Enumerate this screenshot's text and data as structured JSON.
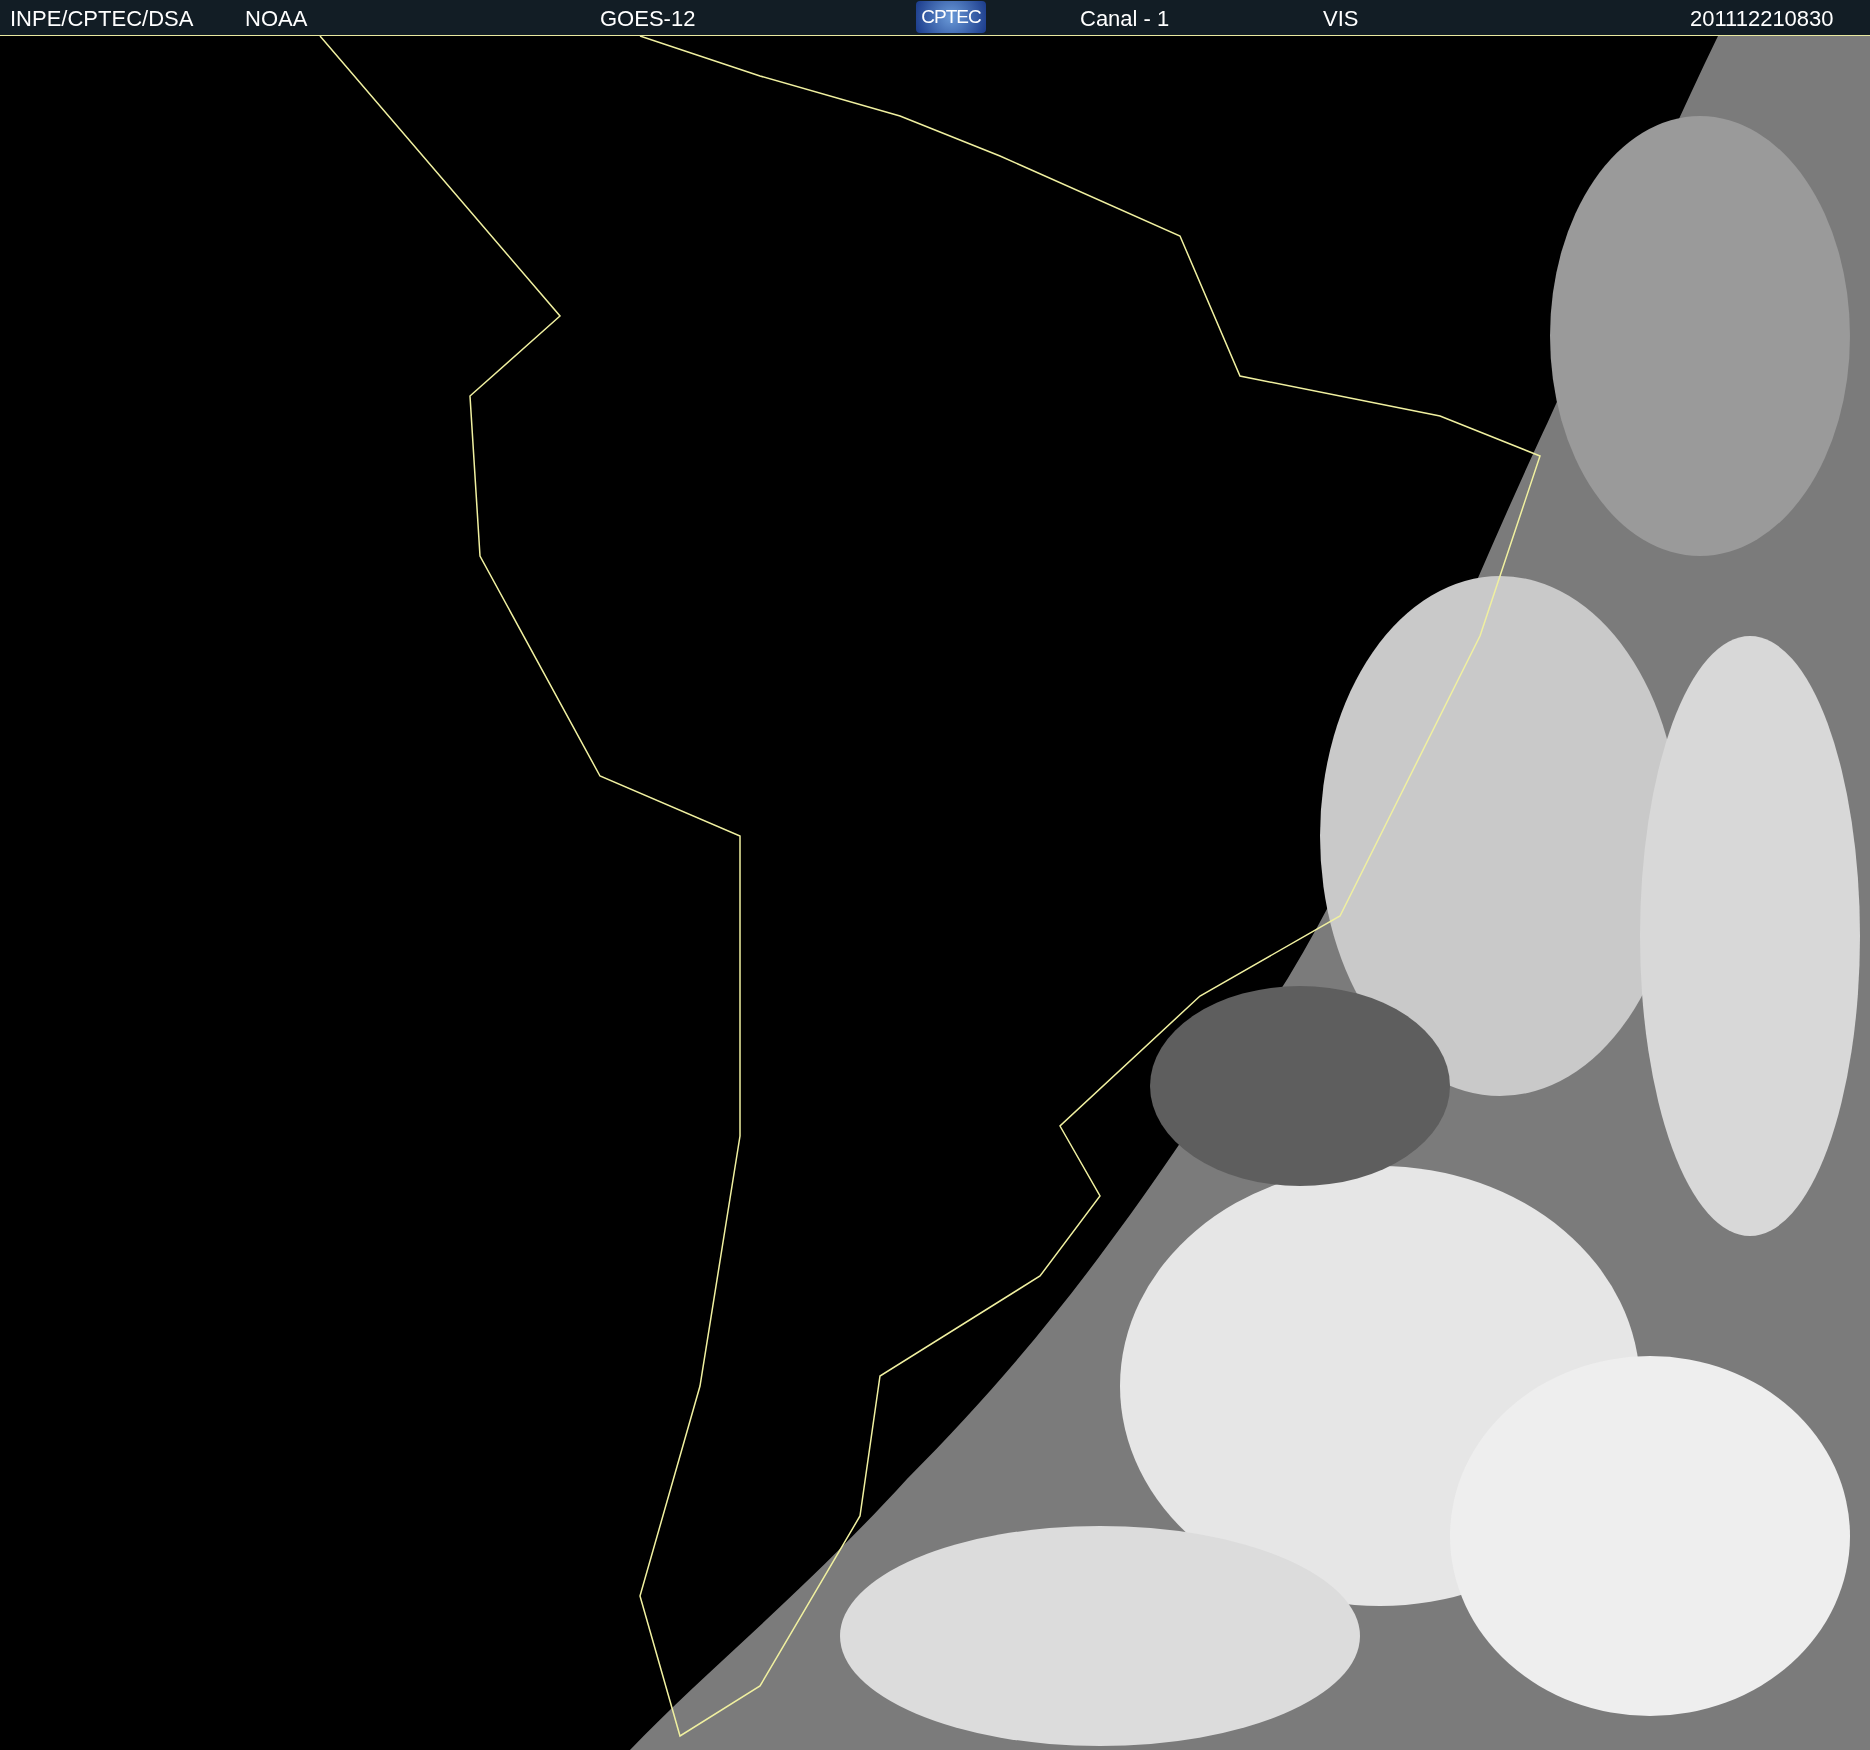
{
  "header": {
    "items": [
      {
        "kind": "text",
        "text": "INPE/CPTEC/DSA"
      },
      {
        "kind": "text",
        "text": "NOAA"
      },
      {
        "kind": "text",
        "text": "GOES-12"
      },
      {
        "kind": "logo",
        "text": "CPTEC"
      },
      {
        "kind": "text",
        "text": "Canal - 1"
      },
      {
        "kind": "text",
        "text": "VIS"
      },
      {
        "kind": "text",
        "text": "201112210830"
      }
    ]
  }
}
